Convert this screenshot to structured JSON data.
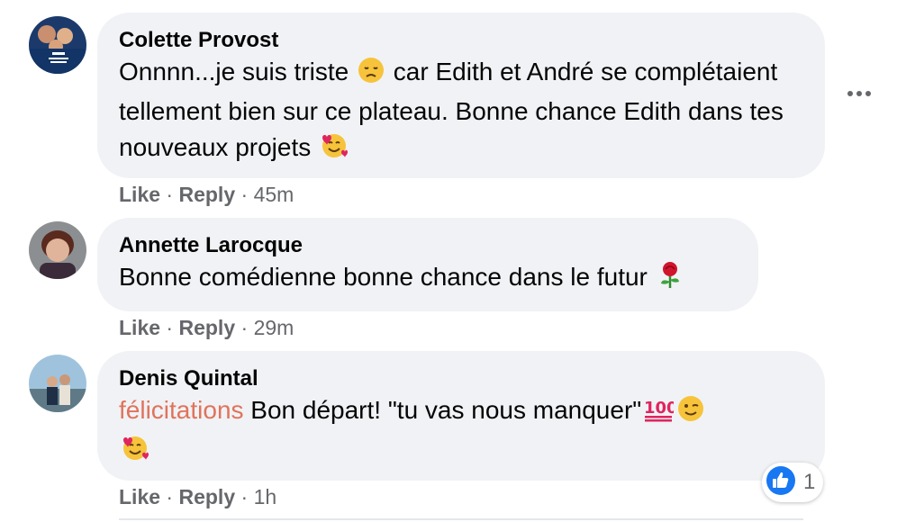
{
  "comments": [
    {
      "author": "Colette Provost",
      "text_before": "Onnnn...je suis triste ",
      "emoji1": "disappointed-face",
      "text_after": " car Edith et André se complétaient tellement bien sur ce plateau. Bonne chance Edith dans tes nouveaux projets ",
      "emoji2": "smiling-face-with-hearts",
      "avatar_text": "SOUTIENS LES TRAVAILLEURS DE LA SANTÉ",
      "like": "Like",
      "reply": "Reply",
      "time": "45m"
    },
    {
      "author": "Annette Larocque",
      "text": "Bonne comédienne bonne chance dans le futur ",
      "emoji": "rose",
      "like": "Like",
      "reply": "Reply",
      "time": "29m"
    },
    {
      "author": "Denis Quintal",
      "mention": "félicitations",
      "text": " Bon départ! \"tu vas nous manquer\"",
      "emoji1": "hundred-points",
      "emoji2": "winking-face",
      "emoji3": "smiling-face-with-hearts",
      "like": "Like",
      "reply": "Reply",
      "time": "1h",
      "reaction_count": "1",
      "reaction_icon": "like-thumb-icon"
    }
  ],
  "separator": "·",
  "colors": {
    "bubble": "#f0f2f5",
    "meta": "#65676b",
    "mention": "#e0735c",
    "like_blue": "#1877f2"
  }
}
